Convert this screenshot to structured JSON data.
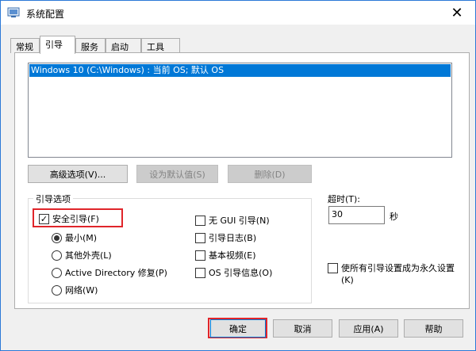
{
  "window": {
    "title": "系统配置",
    "close_symbol": "✕"
  },
  "tabs": [
    "常规",
    "引导",
    "服务",
    "启动",
    "工具"
  ],
  "active_tab": "引导",
  "os_list": {
    "items": [
      "Windows 10 (C:\\Windows) : 当前 OS; 默认 OS"
    ]
  },
  "actions": {
    "advanced": "高级选项(V)...",
    "set_default": "设为默认值(S)",
    "delete": "删除(D)"
  },
  "boot_options": {
    "title": "引导选项",
    "safe_boot": {
      "label": "安全引导(F)",
      "checked": true
    },
    "radios": [
      {
        "label": "最小(M)",
        "selected": true
      },
      {
        "label": "其他外壳(L)",
        "selected": false
      },
      {
        "label": "Active Directory 修复(P)",
        "selected": false
      },
      {
        "label": "网络(W)",
        "selected": false
      }
    ],
    "checks": [
      {
        "label": "无 GUI 引导(N)",
        "checked": false
      },
      {
        "label": "引导日志(B)",
        "checked": false
      },
      {
        "label": "基本视频(E)",
        "checked": false
      },
      {
        "label": "OS 引导信息(O)",
        "checked": false
      }
    ]
  },
  "timeout": {
    "label": "超时(T):",
    "value": "30",
    "unit": "秒"
  },
  "permanent": {
    "label_line1": "使所有引导设置成为永久设置",
    "label_line2": "(K)",
    "checked": false
  },
  "footer": {
    "ok": "确定",
    "cancel": "取消",
    "apply": "应用(A)",
    "help": "帮助"
  },
  "colors": {
    "selection": "#0078d7",
    "highlight": "#e0252a",
    "frame": "#2b79d7"
  }
}
